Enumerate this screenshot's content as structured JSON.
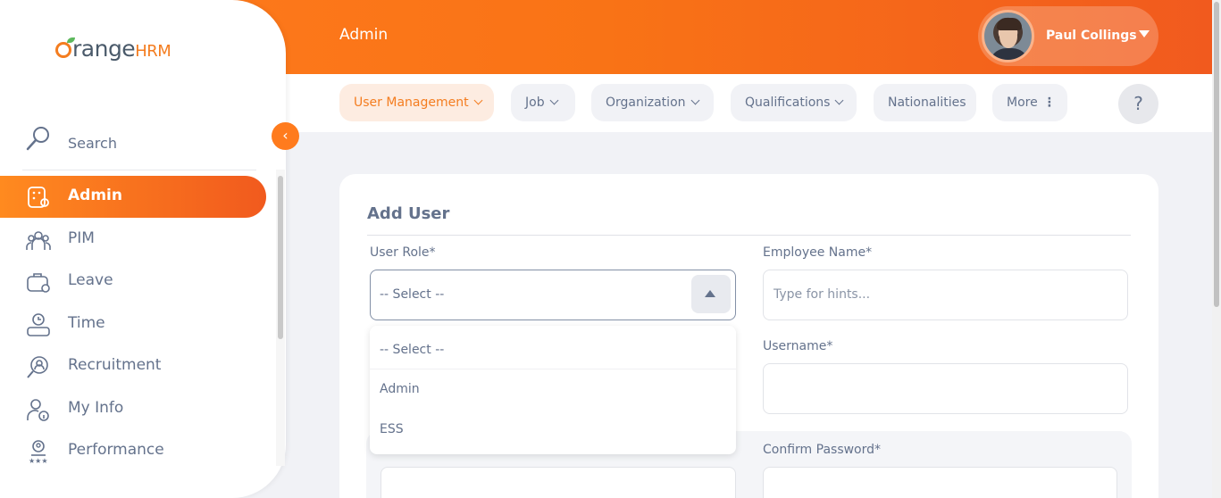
{
  "header": {
    "title": "Admin",
    "user_name": "Paul Collings"
  },
  "nav": {
    "items": [
      {
        "label": "User Management"
      },
      {
        "label": "Job"
      },
      {
        "label": "Organization"
      },
      {
        "label": "Qualifications"
      },
      {
        "label": "Nationalities"
      },
      {
        "label": "More"
      }
    ],
    "help_label": "?"
  },
  "sidebar": {
    "logo_main": "range",
    "logo_suffix": "HRM",
    "search_label": "Search",
    "items": [
      {
        "label": "Admin"
      },
      {
        "label": "PIM"
      },
      {
        "label": "Leave"
      },
      {
        "label": "Time"
      },
      {
        "label": "Recruitment"
      },
      {
        "label": "My Info"
      },
      {
        "label": "Performance"
      }
    ]
  },
  "form": {
    "title": "Add User",
    "user_role_label": "User Role*",
    "user_role_value": "-- Select --",
    "user_role_options": [
      "-- Select --",
      "Admin",
      "ESS"
    ],
    "employee_name_label": "Employee Name*",
    "employee_name_placeholder": "Type for hints...",
    "username_label": "Username*",
    "confirm_password_label": "Confirm Password*"
  },
  "colors": {
    "brand_orange": "#ff7b1d",
    "text": "#64728c"
  }
}
